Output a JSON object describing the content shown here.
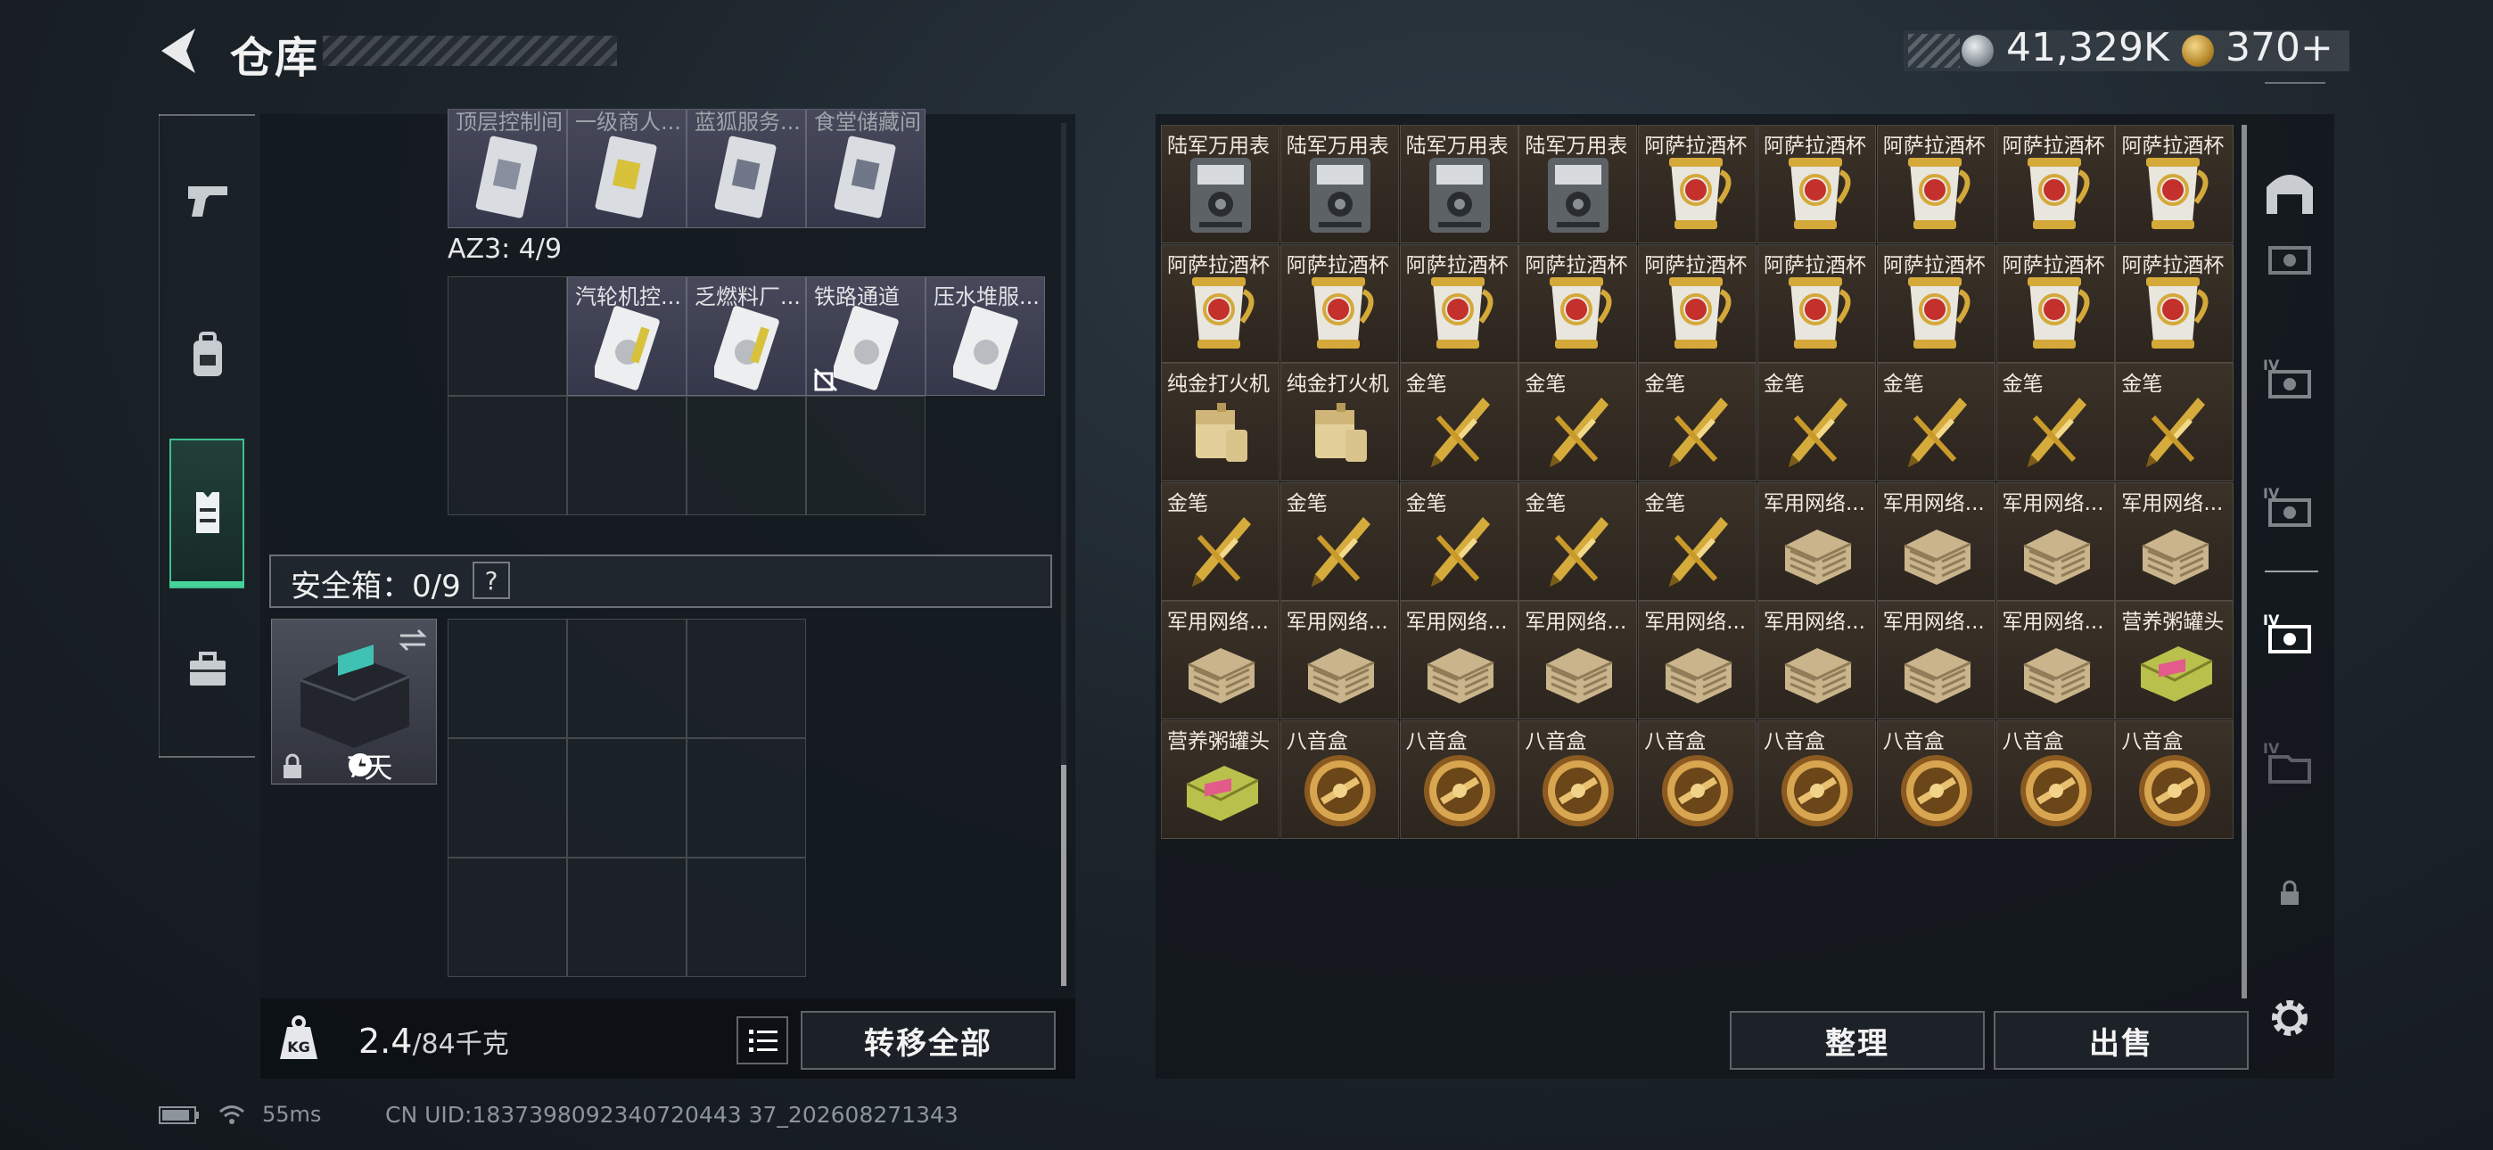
{
  "header": {
    "title": "仓库"
  },
  "currency": {
    "silver": "41,329K",
    "gold": "370+"
  },
  "left_nav": {
    "items": [
      {
        "name": "pistol-icon"
      },
      {
        "name": "backpack-icon"
      },
      {
        "name": "vest-icon",
        "active": true
      },
      {
        "name": "briefcase-icon"
      }
    ]
  },
  "storage": {
    "top_row_labels": [
      "顶层控制间",
      "一级商人...",
      "蓝狐服务...",
      "食堂储藏间"
    ],
    "az3_title": "AZ3: 4/9",
    "az3_labels": [
      "",
      "汽轮机控...",
      "乏燃料厂...",
      "铁路通道",
      "压水堆服..."
    ],
    "safe_title": "安全箱：0/9",
    "help": "?",
    "safe_days": "7天"
  },
  "weight": {
    "current": "2.4",
    "max": "/84千克"
  },
  "buttons": {
    "transfer_all": "转移全部",
    "sort": "整理",
    "sell": "出售"
  },
  "inventory": {
    "rows": [
      [
        "陆军万用表",
        "陆军万用表",
        "陆军万用表",
        "陆军万用表",
        "阿萨拉酒杯",
        "阿萨拉酒杯",
        "阿萨拉酒杯",
        "阿萨拉酒杯",
        "阿萨拉酒杯"
      ],
      [
        "阿萨拉酒杯",
        "阿萨拉酒杯",
        "阿萨拉酒杯",
        "阿萨拉酒杯",
        "阿萨拉酒杯",
        "阿萨拉酒杯",
        "阿萨拉酒杯",
        "阿萨拉酒杯",
        "阿萨拉酒杯"
      ],
      [
        "纯金打火机",
        "纯金打火机",
        "金笔",
        "金笔",
        "金笔",
        "金笔",
        "金笔",
        "金笔",
        "金笔"
      ],
      [
        "金笔",
        "金笔",
        "金笔",
        "金笔",
        "金笔",
        "军用网络...",
        "军用网络...",
        "军用网络...",
        "军用网络..."
      ],
      [
        "军用网络...",
        "军用网络...",
        "军用网络...",
        "军用网络...",
        "军用网络...",
        "军用网络...",
        "军用网络...",
        "军用网络...",
        "营养粥罐头"
      ],
      [
        "营养粥罐头",
        "八音盒",
        "八音盒",
        "八音盒",
        "八音盒",
        "八音盒",
        "八音盒",
        "八音盒",
        "八音盒"
      ]
    ],
    "icon_types": [
      [
        "multimeter",
        "multimeter",
        "multimeter",
        "multimeter",
        "cup",
        "cup",
        "cup",
        "cup",
        "cup"
      ],
      [
        "cup",
        "cup",
        "cup",
        "cup",
        "cup",
        "cup",
        "cup",
        "cup",
        "cup"
      ],
      [
        "lighter",
        "lighter",
        "pen",
        "pen",
        "pen",
        "pen",
        "pen",
        "pen",
        "pen"
      ],
      [
        "pen",
        "pen",
        "pen",
        "pen",
        "pen",
        "router",
        "router",
        "router",
        "router"
      ],
      [
        "router",
        "router",
        "router",
        "router",
        "router",
        "router",
        "router",
        "router",
        "can"
      ],
      [
        "can",
        "musicbox",
        "musicbox",
        "musicbox",
        "musicbox",
        "musicbox",
        "musicbox",
        "musicbox",
        "musicbox"
      ]
    ]
  },
  "footer": {
    "ping": "55ms",
    "uid": "CN UID:1837398092340720443 37_202608271343"
  }
}
